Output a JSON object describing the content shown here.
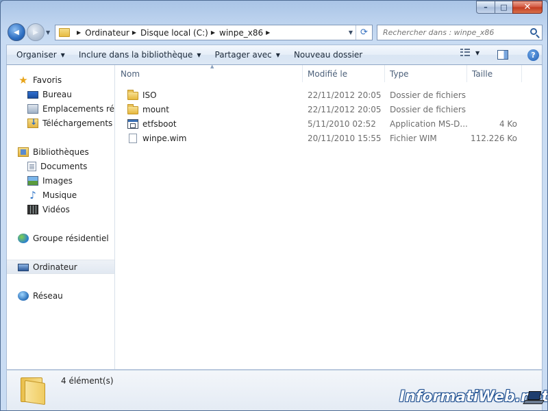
{
  "window": {
    "caption_buttons": {
      "minimize": "–",
      "maximize": "□",
      "close": "✕"
    }
  },
  "nav": {
    "back_glyph": "◀",
    "forward_glyph": "▶",
    "dropdown_glyph": "▼",
    "refresh_glyph": "⟳"
  },
  "address": {
    "separator": "▶",
    "breadcrumbs": [
      "Ordinateur",
      "Disque local (C:)",
      "winpe_x86"
    ],
    "dropdown_glyph": "▼"
  },
  "search": {
    "placeholder": "Rechercher dans : winpe_x86",
    "icon": "search-icon"
  },
  "command_bar": {
    "organiser": "Organiser",
    "include_library": "Inclure dans la bibliothèque",
    "share_with": "Partager avec",
    "new_folder": "Nouveau dossier",
    "caret": "▼",
    "help": "?"
  },
  "sidebar": {
    "favorites": {
      "label": "Favoris",
      "items": [
        {
          "label": "Bureau",
          "icon": "desktop-icon"
        },
        {
          "label": "Emplacements récents",
          "icon": "recent-places-icon"
        },
        {
          "label": "Téléchargements",
          "icon": "downloads-icon"
        }
      ]
    },
    "libraries": {
      "label": "Bibliothèques",
      "items": [
        {
          "label": "Documents",
          "icon": "documents-icon"
        },
        {
          "label": "Images",
          "icon": "pictures-icon"
        },
        {
          "label": "Musique",
          "icon": "music-icon"
        },
        {
          "label": "Vidéos",
          "icon": "videos-icon"
        }
      ]
    },
    "homegroup": {
      "label": "Groupe résidentiel"
    },
    "computer": {
      "label": "Ordinateur"
    },
    "network": {
      "label": "Réseau"
    },
    "star_glyph": "★",
    "music_glyph": "♪"
  },
  "file_list": {
    "columns": {
      "name": "Nom",
      "modified": "Modifié le",
      "type": "Type",
      "size": "Taille"
    },
    "sort_arrow": "▲",
    "rows": [
      {
        "name": "ISO",
        "modified": "22/11/2012 20:05",
        "type": "Dossier de fichiers",
        "size": "",
        "icon": "folder-icon"
      },
      {
        "name": "mount",
        "modified": "22/11/2012 20:05",
        "type": "Dossier de fichiers",
        "size": "",
        "icon": "folder-icon"
      },
      {
        "name": "etfsboot",
        "modified": "5/11/2010 02:52",
        "type": "Application MS-D...",
        "size": "4 Ko",
        "icon": "application-icon"
      },
      {
        "name": "winpe.wim",
        "modified": "20/11/2010 15:55",
        "type": "Fichier WIM",
        "size": "112.226 Ko",
        "icon": "file-icon"
      }
    ]
  },
  "details": {
    "count": "4 élément(s)"
  },
  "watermark": {
    "text": "InformatiWeb.net"
  }
}
